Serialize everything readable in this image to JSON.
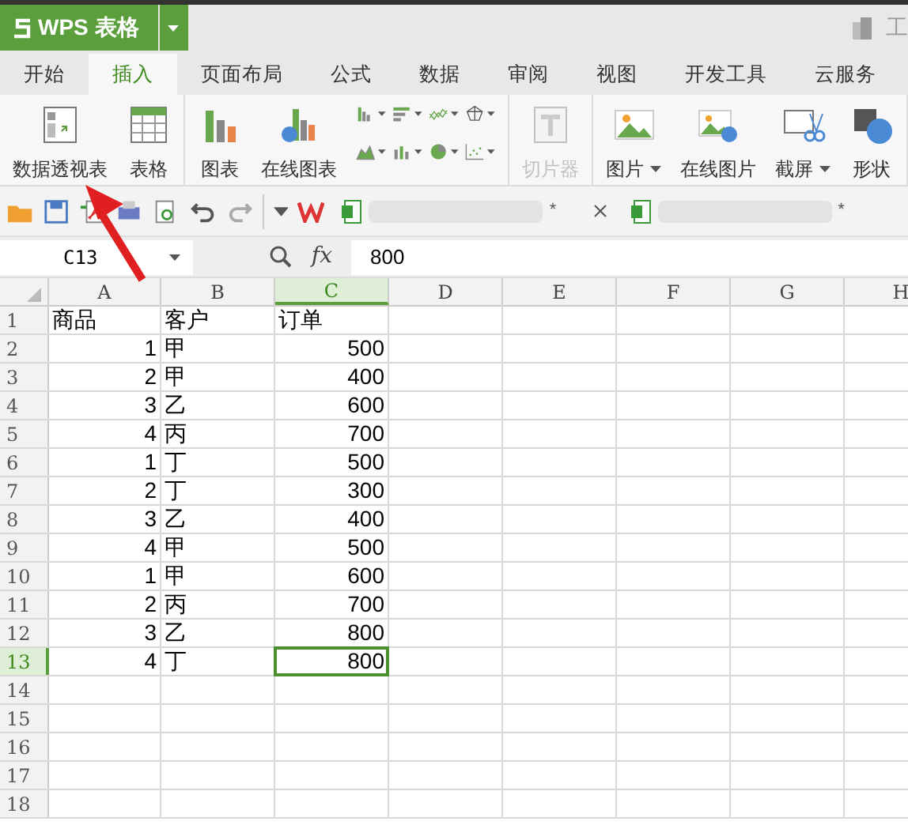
{
  "app_button": {
    "label": "WPS 表格"
  },
  "title_right": "工",
  "tabs": [
    {
      "label": "开始",
      "selected": false
    },
    {
      "label": "插入",
      "selected": true
    },
    {
      "label": "页面布局",
      "selected": false
    },
    {
      "label": "公式",
      "selected": false
    },
    {
      "label": "数据",
      "selected": false
    },
    {
      "label": "审阅",
      "selected": false
    },
    {
      "label": "视图",
      "selected": false
    },
    {
      "label": "开发工具",
      "selected": false
    },
    {
      "label": "云服务",
      "selected": false
    }
  ],
  "ribbon": [
    [
      {
        "kind": "pivot",
        "label": "数据透视表",
        "dropdown": false,
        "disabled": false
      },
      {
        "kind": "table",
        "label": "表格",
        "dropdown": false,
        "disabled": false
      }
    ],
    [
      {
        "kind": "chart",
        "label": "图表",
        "dropdown": false,
        "disabled": false
      },
      {
        "kind": "online-chart",
        "label": "在线图表",
        "dropdown": false,
        "disabled": false
      },
      {
        "kind": "chart-grid"
      }
    ],
    [
      {
        "kind": "slicer",
        "label": "切片器",
        "dropdown": false,
        "disabled": true
      }
    ],
    [
      {
        "kind": "picture",
        "label": "图片",
        "dropdown": true,
        "disabled": false
      },
      {
        "kind": "online-picture",
        "label": "在线图片",
        "dropdown": false,
        "disabled": false
      },
      {
        "kind": "screenshot",
        "label": "截屏",
        "dropdown": true,
        "disabled": false
      },
      {
        "kind": "shape",
        "label": "形状",
        "dropdown": false,
        "disabled": false
      }
    ]
  ],
  "doc_tabs": [
    {
      "mark": "*",
      "closable": true
    },
    {
      "mark": "*",
      "closable": false
    }
  ],
  "formula_bar": {
    "cell_ref": "C13",
    "fx": "fx",
    "value": "800"
  },
  "sheet": {
    "columns": [
      {
        "label": "A",
        "selected": false
      },
      {
        "label": "B",
        "selected": false
      },
      {
        "label": "C",
        "selected": true
      },
      {
        "label": "D",
        "selected": false
      },
      {
        "label": "E",
        "selected": false
      },
      {
        "label": "F",
        "selected": false
      },
      {
        "label": "G",
        "selected": false
      },
      {
        "label": "H",
        "selected": false
      }
    ],
    "rows": [
      {
        "number": "1",
        "kind": "header",
        "selected": false,
        "cells": [
          "商品",
          "客户",
          "订单"
        ]
      },
      {
        "number": "2",
        "kind": "data",
        "selected": false,
        "cells": [
          "1",
          "甲",
          "500"
        ]
      },
      {
        "number": "3",
        "kind": "data",
        "selected": false,
        "cells": [
          "2",
          "甲",
          "400"
        ]
      },
      {
        "number": "4",
        "kind": "data",
        "selected": false,
        "cells": [
          "3",
          "乙",
          "600"
        ]
      },
      {
        "number": "5",
        "kind": "data",
        "selected": false,
        "cells": [
          "4",
          "丙",
          "700"
        ]
      },
      {
        "number": "6",
        "kind": "data",
        "selected": false,
        "cells": [
          "1",
          "丁",
          "500"
        ]
      },
      {
        "number": "7",
        "kind": "data",
        "selected": false,
        "cells": [
          "2",
          "丁",
          "300"
        ]
      },
      {
        "number": "8",
        "kind": "data",
        "selected": false,
        "cells": [
          "3",
          "乙",
          "400"
        ]
      },
      {
        "number": "9",
        "kind": "data",
        "selected": false,
        "cells": [
          "4",
          "甲",
          "500"
        ]
      },
      {
        "number": "10",
        "kind": "data",
        "selected": false,
        "cells": [
          "1",
          "甲",
          "600"
        ]
      },
      {
        "number": "11",
        "kind": "data",
        "selected": false,
        "cells": [
          "2",
          "丙",
          "700"
        ]
      },
      {
        "number": "12",
        "kind": "data",
        "selected": false,
        "cells": [
          "3",
          "乙",
          "800"
        ]
      },
      {
        "number": "13",
        "kind": "data",
        "selected": true,
        "cells": [
          "4",
          "丁",
          "800"
        ]
      },
      {
        "number": "14",
        "kind": "empty",
        "selected": false
      },
      {
        "number": "15",
        "kind": "empty",
        "selected": false
      },
      {
        "number": "16",
        "kind": "empty",
        "selected": false
      },
      {
        "number": "17",
        "kind": "empty",
        "selected": false
      },
      {
        "number": "18",
        "kind": "empty",
        "selected": false
      }
    ]
  }
}
